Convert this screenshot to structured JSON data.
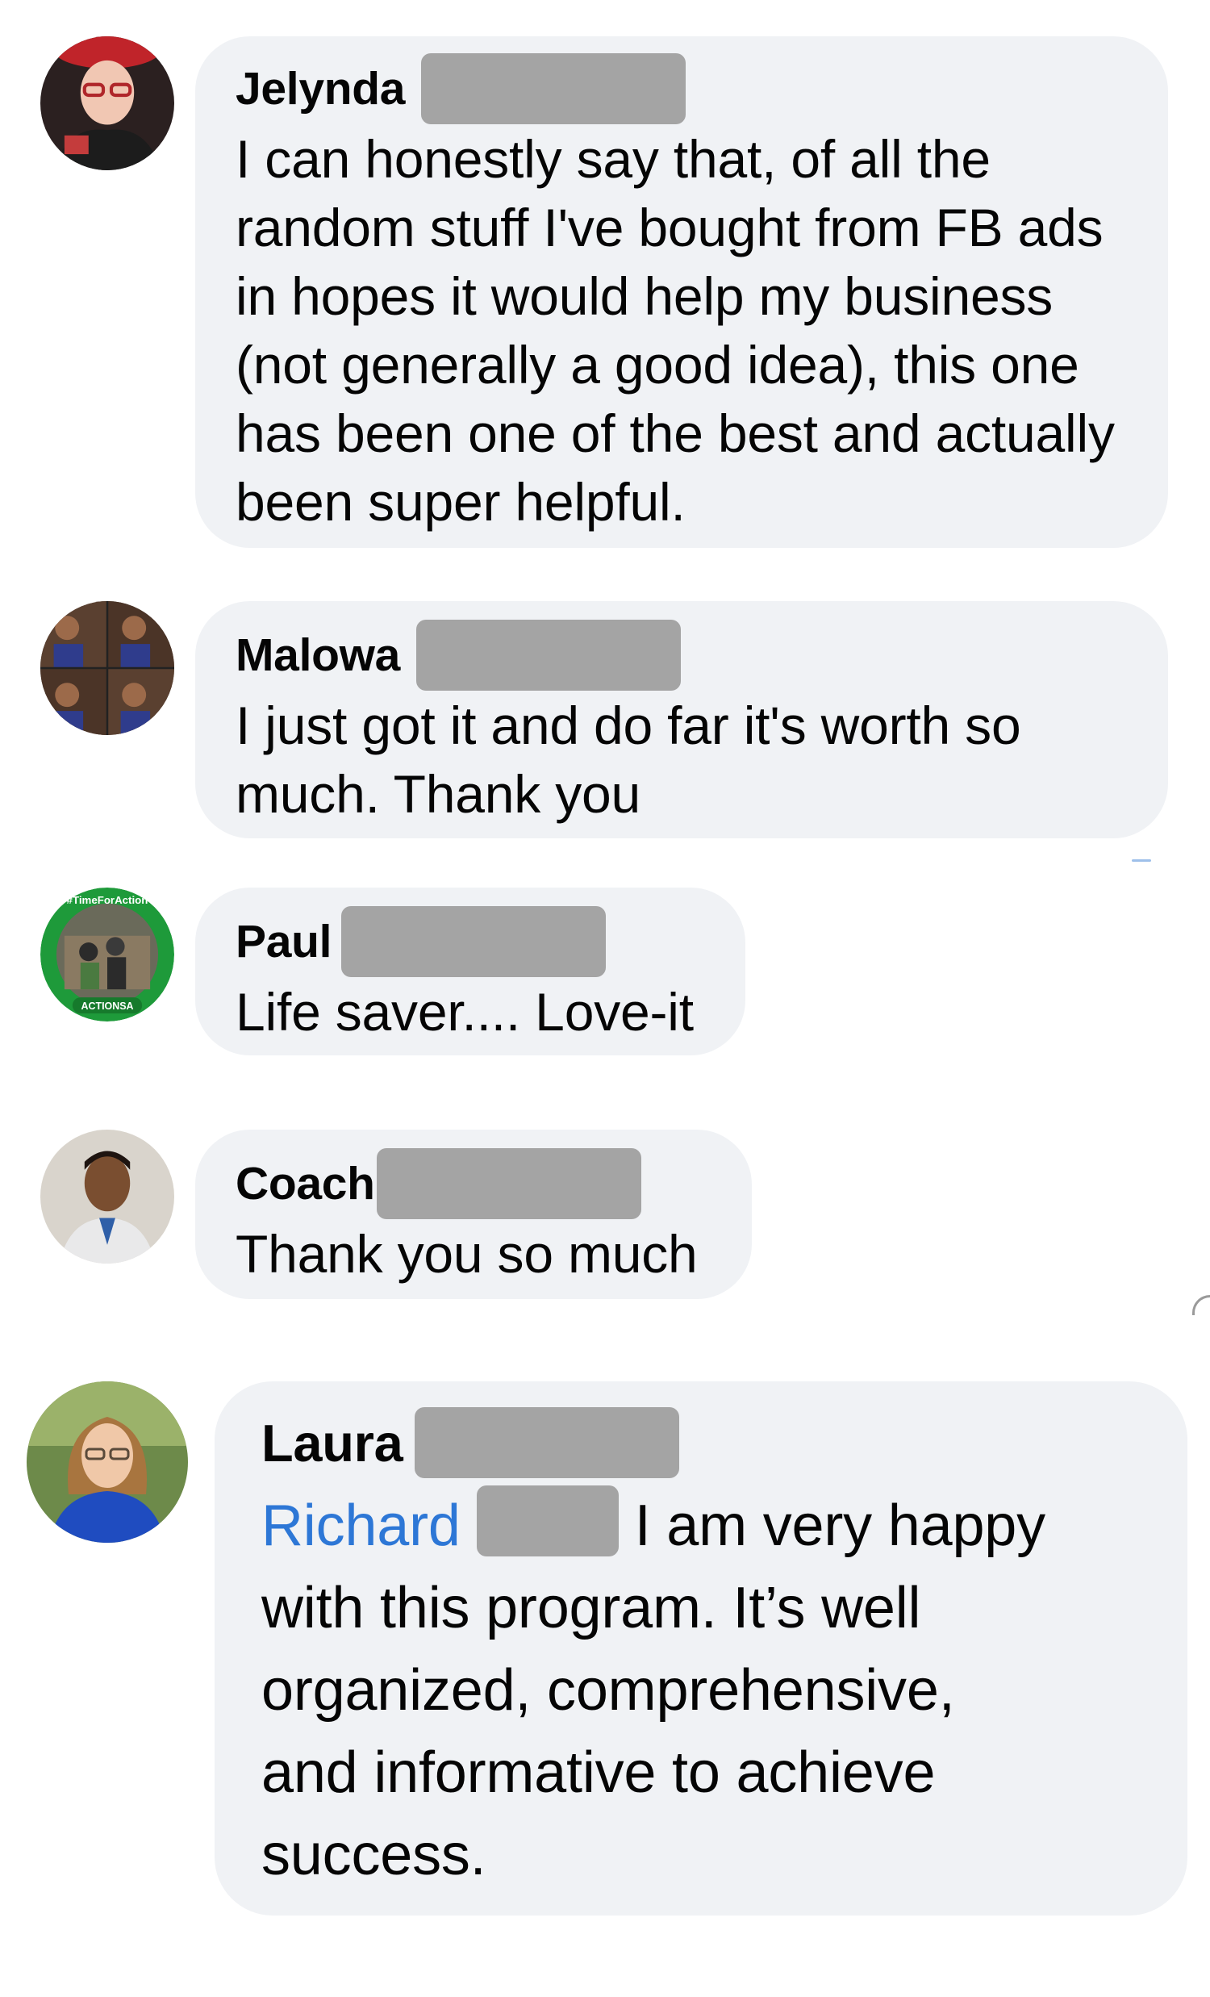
{
  "comments": [
    {
      "author": "Jelynda",
      "text": "I can honestly say that, of all the\nrandom stuff I've bought from FB ads\nin hopes it would help my business\n(not generally a good idea), this one\nhas been one of the best and actually\nbeen super helpful."
    },
    {
      "author": "Malowa",
      "text": "I just got it and do far it's worth so\nmuch. Thank you"
    },
    {
      "author": "Paul",
      "text": "Life saver.... Love-it",
      "avatar_badge_top": "#TimeForAction",
      "avatar_badge_bottom": "ACTIONSA"
    },
    {
      "author": "Coach",
      "text": "Thank you so much"
    },
    {
      "author": "Laura",
      "mention": "Richard",
      "text_after_mention": "I am very happy",
      "text_rest": "with this program. It’s well\norganized, comprehensive,\nand informative to achieve\nsuccess."
    }
  ],
  "colors": {
    "bubble_bg": "#f0f2f5",
    "text": "#050505",
    "mention": "#2d77d6",
    "redaction": "#a4a4a4"
  }
}
